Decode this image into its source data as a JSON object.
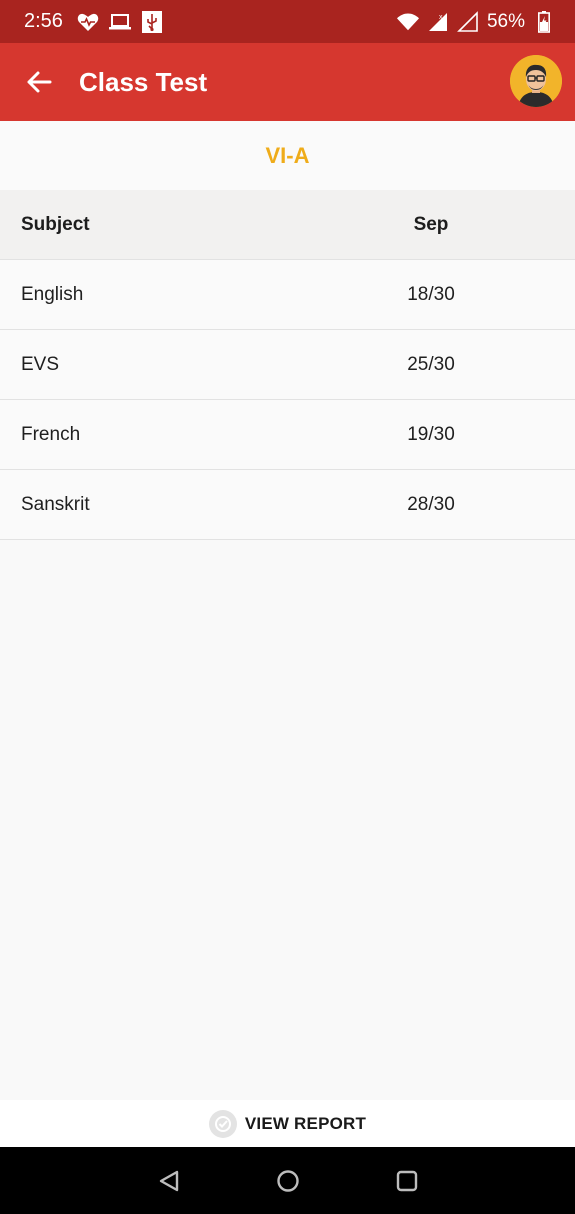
{
  "status_bar": {
    "time": "2:56",
    "battery": "56%",
    "left_icons": [
      "heart-pulse-icon",
      "laptop-icon",
      "usb-icon"
    ],
    "right_icons": [
      "wifi-icon",
      "signal-icon",
      "signal-empty-icon",
      "battery-charging-icon"
    ]
  },
  "app_bar": {
    "title": "Class Test",
    "color": "#d6372f"
  },
  "class_label": "VI-A",
  "table": {
    "headers": {
      "subject": "Subject",
      "month": "Sep"
    },
    "rows": [
      {
        "subject": "English",
        "score": "18/30"
      },
      {
        "subject": "EVS",
        "score": "25/30"
      },
      {
        "subject": "French",
        "score": "19/30"
      },
      {
        "subject": "Sanskrit",
        "score": "28/30"
      }
    ]
  },
  "bottom_action": {
    "label": "VIEW REPORT",
    "icon": "report-check-icon"
  },
  "colors": {
    "status_bar": "#a9241f",
    "accent": "#efac1a"
  }
}
